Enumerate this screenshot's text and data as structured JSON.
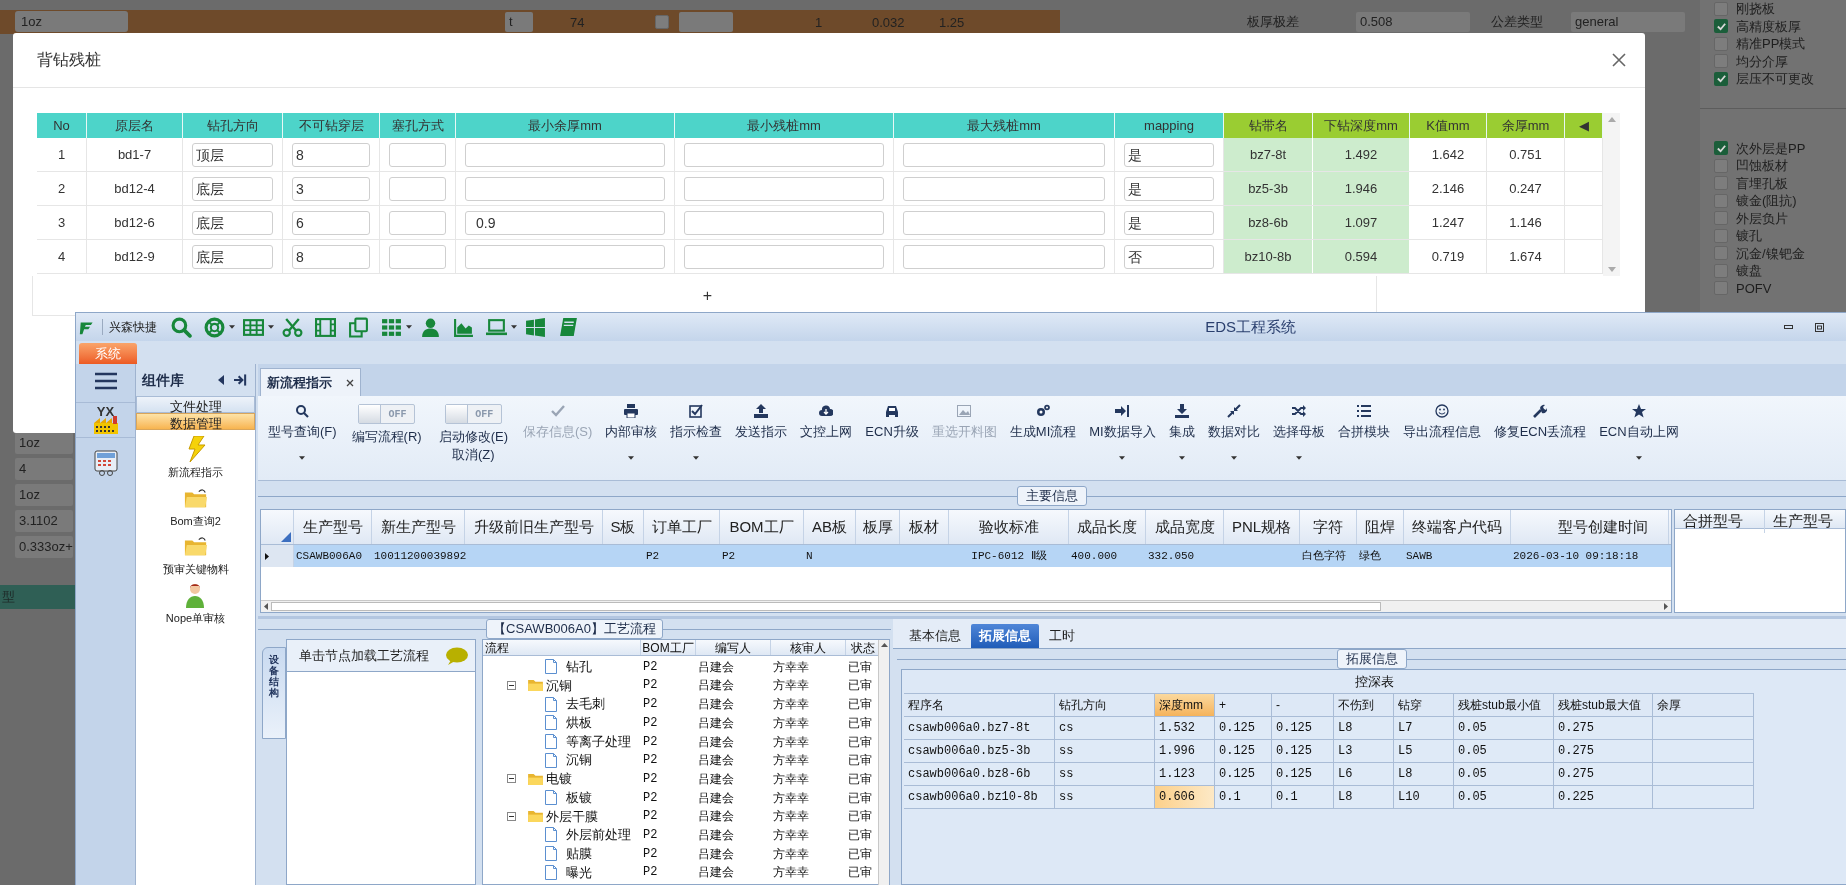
{
  "background": {
    "top_row": {
      "field": "1oz",
      "small_box": "t",
      "count": "74",
      "checked": false,
      "value_1": "1",
      "value_2": "0.032",
      "value_3": "1.25"
    },
    "fields": [
      {
        "label": "板厚极差",
        "value": "0.508"
      },
      {
        "label": "公差类型",
        "value": "general"
      }
    ],
    "options_1": [
      {
        "label": "刚挠板",
        "checked": false
      },
      {
        "label": "高精度板厚",
        "checked": true
      },
      {
        "label": "精准PP模式",
        "checked": false
      },
      {
        "label": "均分介厚",
        "checked": false
      },
      {
        "label": "层压不可更改",
        "checked": true
      }
    ],
    "options_2": [
      {
        "label": "次外层是PP",
        "checked": true
      },
      {
        "label": "凹蚀板材",
        "checked": false
      },
      {
        "label": "盲埋孔板",
        "checked": false
      },
      {
        "label": "镀金(阻抗)",
        "checked": false
      },
      {
        "label": "外层负片",
        "checked": false
      },
      {
        "label": "镀孔",
        "checked": false
      },
      {
        "label": "沉金/镍钯金",
        "checked": false
      },
      {
        "label": "镀盘",
        "checked": false
      },
      {
        "label": "POFV",
        "checked": false
      }
    ],
    "left_values": [
      "1oz",
      "4",
      "1oz",
      "3.1102",
      "0.333oz+"
    ],
    "left_footer": "型"
  },
  "dialog": {
    "title": "背钻残桩",
    "columns": [
      {
        "label": "No",
        "color": "#4dd4c9",
        "kind": "text"
      },
      {
        "label": "原层名",
        "color": "#4dd4c9",
        "kind": "text"
      },
      {
        "label": "钻孔方向",
        "color": "#4dd4c9",
        "kind": "input"
      },
      {
        "label": "不可钻穿层",
        "color": "#4dd4c9",
        "kind": "input"
      },
      {
        "label": "塞孔方式",
        "color": "#4dd4c9",
        "kind": "input"
      },
      {
        "label": "最小余厚mm",
        "color": "#4dd4c9",
        "kind": "input"
      },
      {
        "label": "最小残桩mm",
        "color": "#4dd4c9",
        "kind": "input"
      },
      {
        "label": "最大残桩mm",
        "color": "#4dd4c9",
        "kind": "input"
      },
      {
        "label": "mapping",
        "color": "#4dd4c9",
        "kind": "input"
      },
      {
        "label": "钻带名",
        "color": "#9acd32",
        "kind": "shaded"
      },
      {
        "label": "下钻深度mm",
        "color": "#9acd32",
        "kind": "shaded"
      },
      {
        "label": "K值mm",
        "color": "#9acd32",
        "kind": "text"
      },
      {
        "label": "余厚mm",
        "color": "#9acd32",
        "kind": "text"
      },
      {
        "label": "◀",
        "color": "#9acd32",
        "kind": "text"
      }
    ],
    "rows": [
      [
        "1",
        "bd1-7",
        "顶层",
        "8",
        null,
        null,
        null,
        null,
        "是",
        "bz7-8t",
        "1.492",
        "1.642",
        "0.751",
        null
      ],
      [
        "2",
        "bd12-4",
        "底层",
        "3",
        null,
        null,
        null,
        null,
        "是",
        "bz5-3b",
        "1.946",
        "2.146",
        "0.247",
        null
      ],
      [
        "3",
        "bd12-6",
        "底层",
        "6",
        null,
        "0.9",
        null,
        null,
        "是",
        "bz8-6b",
        "1.097",
        "1.247",
        "1.146",
        null
      ],
      [
        "4",
        "bd12-9",
        "底层",
        "8",
        null,
        null,
        null,
        null,
        "否",
        "bz10-8b",
        "0.594",
        "0.719",
        "1.674",
        null
      ]
    ],
    "add_label": "+"
  },
  "app": {
    "brand": "兴森快捷",
    "title": "EDS工程系统",
    "menu_tab": "系统",
    "badge": "YX",
    "library": {
      "title": "组件库",
      "groups": [
        {
          "label": "文件处理",
          "selected": false
        },
        {
          "label": "数据管理",
          "selected": true
        }
      ],
      "items": [
        "新流程指示",
        "Bom查询2",
        "预审关键物料",
        "Nope单审核"
      ]
    },
    "doc_tabs": [
      {
        "label": "新流程指示",
        "selected": true
      }
    ],
    "ribbon": [
      {
        "kind": "button",
        "label": "型号查询(F)",
        "disabled": false,
        "menu": true
      },
      {
        "kind": "toggle",
        "label": "编写流程(R)",
        "state_text": "OFF",
        "on": false
      },
      {
        "kind": "toggle",
        "label": "启动修改(E)",
        "sub_label": "取消(Z)",
        "state_text": "OFF",
        "on": false
      },
      {
        "kind": "button",
        "label": "保存信息(S)",
        "disabled": true,
        "menu": false
      },
      {
        "kind": "button",
        "label": "内部审核",
        "disabled": false,
        "menu": true
      },
      {
        "kind": "button",
        "label": "指示检查",
        "disabled": false,
        "menu": true
      },
      {
        "kind": "button",
        "label": "发送指示",
        "disabled": false,
        "menu": false
      },
      {
        "kind": "button",
        "label": "文控上网",
        "disabled": false,
        "menu": false
      },
      {
        "kind": "button",
        "label": "ECN升级",
        "disabled": false,
        "menu": false
      },
      {
        "kind": "button",
        "label": "重选开料图",
        "disabled": true,
        "menu": false
      },
      {
        "kind": "button",
        "label": "生成MI流程",
        "disabled": false,
        "menu": false
      },
      {
        "kind": "button",
        "label": "MI数据导入",
        "disabled": false,
        "menu": true
      },
      {
        "kind": "button",
        "label": "集成",
        "disabled": false,
        "menu": true
      },
      {
        "kind": "button",
        "label": "数据对比",
        "disabled": false,
        "menu": true
      },
      {
        "kind": "button",
        "label": "选择母板",
        "disabled": false,
        "menu": true
      },
      {
        "kind": "button",
        "label": "合拼模块",
        "disabled": false,
        "menu": false
      },
      {
        "kind": "button",
        "label": "导出流程信息",
        "disabled": false,
        "menu": false
      },
      {
        "kind": "button",
        "label": "修复ECN丢流程",
        "disabled": false,
        "menu": false
      },
      {
        "kind": "button",
        "label": "ECN自动上网",
        "disabled": false,
        "menu": true
      }
    ],
    "main_info": {
      "title": "主要信息",
      "columns": [
        "生产型号",
        "新生产型号",
        "升级前旧生产型号",
        "S板",
        "订单工厂",
        "BOM工厂",
        "AB板",
        "板厚",
        "板材",
        "验收标准",
        "成品长度",
        "成品宽度",
        "PNL规格",
        "字符",
        "阻焊",
        "终端客户代码",
        "型号创建时间"
      ],
      "rows": [
        {
          "selected": true,
          "cells": [
            "CSAWB006A0",
            "10011200039892",
            null,
            null,
            "P2",
            "P2",
            "N",
            null,
            null,
            "IPC-6012 Ⅱ级",
            "400.000",
            "332.050",
            null,
            "白色字符",
            "绿色",
            "SAWB",
            "2026-03-10 09:18:18"
          ]
        }
      ],
      "merge_columns": [
        "合拼型号",
        "生产型号"
      ]
    },
    "flow": {
      "title": "【CSAWB006A0】工艺流程",
      "side_tab": "设备结构",
      "hint": "单击节点加载工艺流程",
      "columns": [
        "流程",
        "BOM工厂",
        "编写人",
        "核审人",
        "状态"
      ],
      "tree": [
        {
          "children": [
            {
              "name": "钻孔",
              "kind": "file",
              "cells": [
                "P2",
                "吕建会",
                "方幸幸",
                "已审"
              ]
            }
          ]
        },
        {
          "name": "沉铜",
          "kind": "folder",
          "expanded": true,
          "cells": [
            "P2",
            "吕建会",
            "方幸幸",
            "已审"
          ],
          "children": [
            {
              "name": "去毛刺",
              "kind": "file",
              "cells": [
                "P2",
                "吕建会",
                "方幸幸",
                "已审"
              ]
            },
            {
              "name": "烘板",
              "kind": "file",
              "cells": [
                "P2",
                "吕建会",
                "方幸幸",
                "已审"
              ]
            },
            {
              "name": "等离子处理",
              "kind": "file",
              "cells": [
                "P2",
                "吕建会",
                "方幸幸",
                "已审"
              ]
            },
            {
              "name": "沉铜",
              "kind": "file",
              "cells": [
                "P2",
                "吕建会",
                "方幸幸",
                "已审"
              ]
            }
          ]
        },
        {
          "name": "电镀",
          "kind": "folder",
          "expanded": true,
          "cells": [
            "P2",
            "吕建会",
            "方幸幸",
            "已审"
          ],
          "children": [
            {
              "name": "板镀",
              "kind": "file",
              "cells": [
                "P2",
                "吕建会",
                "方幸幸",
                "已审"
              ]
            }
          ]
        },
        {
          "name": "外层干膜",
          "kind": "folder",
          "expanded": true,
          "cells": [
            "P2",
            "吕建会",
            "方幸幸",
            "已审"
          ],
          "children": [
            {
              "name": "外层前处理",
              "kind": "file",
              "cells": [
                "P2",
                "吕建会",
                "方幸幸",
                "已审"
              ]
            },
            {
              "name": "贴膜",
              "kind": "file",
              "cells": [
                "P2",
                "吕建会",
                "方幸幸",
                "已审"
              ]
            },
            {
              "name": "曝光",
              "kind": "file",
              "cells": [
                "P2",
                "吕建会",
                "方幸幸",
                "已审"
              ]
            }
          ]
        }
      ]
    },
    "detail_tabs": [
      {
        "label": "基本信息",
        "selected": false
      },
      {
        "label": "拓展信息",
        "selected": true
      },
      {
        "label": "工时",
        "selected": false
      }
    ],
    "ext": {
      "title": "拓展信息",
      "table_title": "控深表",
      "columns": [
        {
          "label": "程序名",
          "selected": false
        },
        {
          "label": "钻孔方向",
          "selected": false
        },
        {
          "label": "深度mm",
          "selected": true
        },
        {
          "label": "+",
          "selected": false
        },
        {
          "label": "-",
          "selected": false
        },
        {
          "label": "不伤到",
          "selected": false
        },
        {
          "label": "钻穿",
          "selected": false
        },
        {
          "label": "残桩stub最小值",
          "selected": false
        },
        {
          "label": "残桩stub最大值",
          "selected": false
        },
        {
          "label": "余厚",
          "selected": false
        }
      ],
      "rows": [
        {
          "active": false,
          "cells": [
            "csawb006a0.bz7-8t",
            "cs",
            "1.532",
            "0.125",
            "0.125",
            "L8",
            "L7",
            "0.05",
            "0.275",
            null
          ]
        },
        {
          "active": false,
          "cells": [
            "csawb006a0.bz5-3b",
            "ss",
            "1.996",
            "0.125",
            "0.125",
            "L3",
            "L5",
            "0.05",
            "0.275",
            null
          ]
        },
        {
          "active": false,
          "cells": [
            "csawb006a0.bz8-6b",
            "ss",
            "1.123",
            "0.125",
            "0.125",
            "L6",
            "L8",
            "0.05",
            "0.275",
            null
          ]
        },
        {
          "active": true,
          "cells": [
            "csawb006a0.bz10-8b",
            "ss",
            "0.606",
            "0.1",
            "0.1",
            "L8",
            "L10",
            "0.05",
            "0.225",
            null
          ]
        }
      ]
    }
  }
}
